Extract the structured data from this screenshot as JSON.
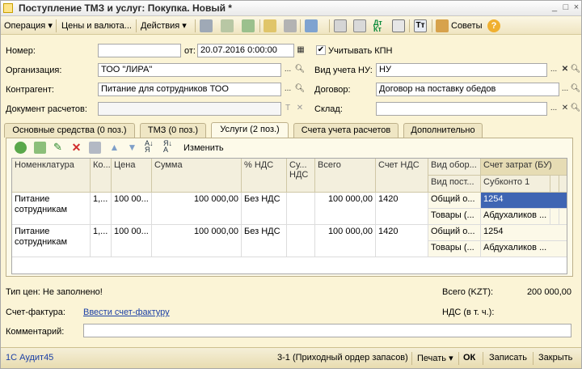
{
  "window": {
    "title": "Поступление ТМЗ и услуг: Покупка. Новый *"
  },
  "toolbar": {
    "operation": "Операция",
    "prices": "Цены и валюта...",
    "actions": "Действия",
    "tips": "Советы",
    "help": "?"
  },
  "form": {
    "number_label": "Номер:",
    "number_value": "",
    "date_label": "от:",
    "date_value": "20.07.2016  0:00:00",
    "kpn_label": "Учитывать КПН",
    "kpn_checked": true,
    "org_label": "Организация:",
    "org_value": "ТОО \"ЛИРА\"",
    "nu_label": "Вид учета НУ:",
    "nu_value": "НУ",
    "contractor_label": "Контрагент:",
    "contractor_value": "Питание для сотрудников ТОО",
    "contract_label": "Договор:",
    "contract_value": "Договор на поставку обедов",
    "payment_doc_label": "Документ расчетов:",
    "payment_doc_value": "",
    "warehouse_label": "Склад:",
    "warehouse_value": ""
  },
  "tabs": [
    {
      "label": "Основные средства (0 поз.)"
    },
    {
      "label": "ТМЗ (0 поз.)"
    },
    {
      "label": "Услуги (2 поз.)"
    },
    {
      "label": "Счета учета расчетов"
    },
    {
      "label": "Дополнительно"
    }
  ],
  "tab_toolbar": {
    "change_label": "Изменить"
  },
  "table": {
    "headers": {
      "nomenclature": "Номенклатура",
      "qty": "Ко...",
      "price": "Цена",
      "sum": "Сумма",
      "vat_rate": "% НДС",
      "vat_sum": "Су... НДС",
      "total": "Всего",
      "vat_account": "Счет НДС",
      "turnover_type": "Вид обор...",
      "cost_account": "Счет затрат (БУ)",
      "expense_type": "Вид пост...",
      "subconto": "Субконто 1"
    },
    "rows": [
      {
        "nomenclature": "Питание сотрудникам",
        "qty": "1,...",
        "price": "100 00...",
        "sum": "100 000,00",
        "vat_rate": "Без НДС",
        "vat_sum": "",
        "total": "100 000,00",
        "vat_account": "1420",
        "turnover_type": "Общий о...",
        "expense_type": "Товары (...",
        "cost_account": "1254",
        "subconto": "Абдухаликов ..."
      },
      {
        "nomenclature": "Питание сотрудникам",
        "qty": "1,...",
        "price": "100 00...",
        "sum": "100 000,00",
        "vat_rate": "Без НДС",
        "vat_sum": "",
        "total": "100 000,00",
        "vat_account": "1420",
        "turnover_type": "Общий о...",
        "expense_type": "Товары (...",
        "cost_account": "1254",
        "subconto": "Абдухаликов ..."
      }
    ]
  },
  "summary": {
    "price_type": "Тип цен: Не заполнено!",
    "total_label": "Всего (KZT):",
    "total_value": "200 000,00",
    "invoice_label": "Счет-фактура:",
    "invoice_link": "Ввести счет-фактуру",
    "vat_label": "НДС (в т. ч.):",
    "vat_value": "",
    "comment_label": "Комментарий:",
    "comment_value": ""
  },
  "statusbar": {
    "app": "1С Аудит45",
    "print_form": "3-1 (Приходный ордер запасов)",
    "print": "Печать",
    "ok": "ОК",
    "save": "Записать",
    "close": "Закрыть"
  },
  "colors": {
    "background": "#fbf4d6",
    "selection": "#3f65b3",
    "link": "#1a3fa6"
  }
}
